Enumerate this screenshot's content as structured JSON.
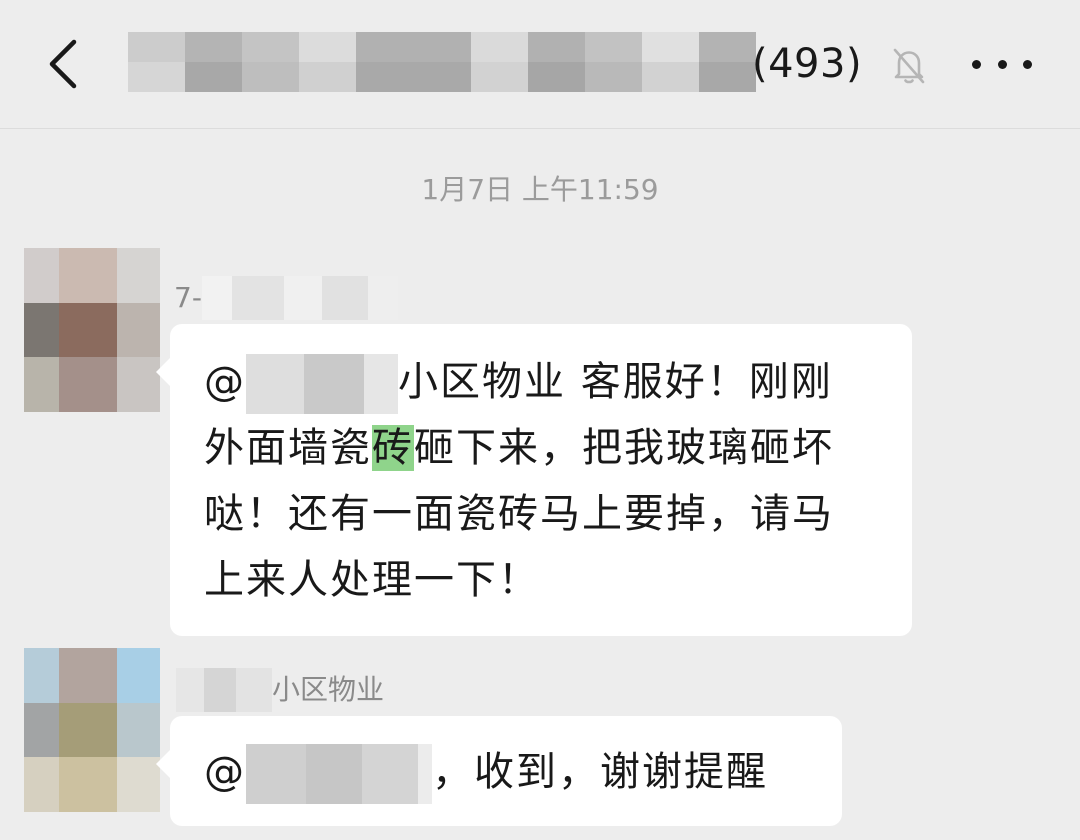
{
  "header": {
    "back_icon": "chevron-left-icon",
    "member_count": "(493)",
    "mute_icon": "bell-slash-icon",
    "more_icon": "ellipsis-icon"
  },
  "timestamp": "1月7日 上午11:59",
  "messages": [
    {
      "sender_prefix": "7-",
      "mention": "@",
      "line1_after_mention": "小区物业 客服好！刚刚",
      "line2_before": "外面墙瓷",
      "line2_highlight": "砖",
      "line2_after": "砸下来，把我玻璃砸坏",
      "line3": "哒！还有一面瓷砖马上要掉，请马",
      "line4": "上来人处理一下！"
    },
    {
      "sender_suffix": "小区物业",
      "mention": "@",
      "text_after_mention": "，收到，谢谢提醒"
    }
  ],
  "colors": {
    "background": "#ededed",
    "bubble": "#ffffff",
    "highlight": "#8fd48b",
    "timestamp_text": "#9b9b9b"
  }
}
